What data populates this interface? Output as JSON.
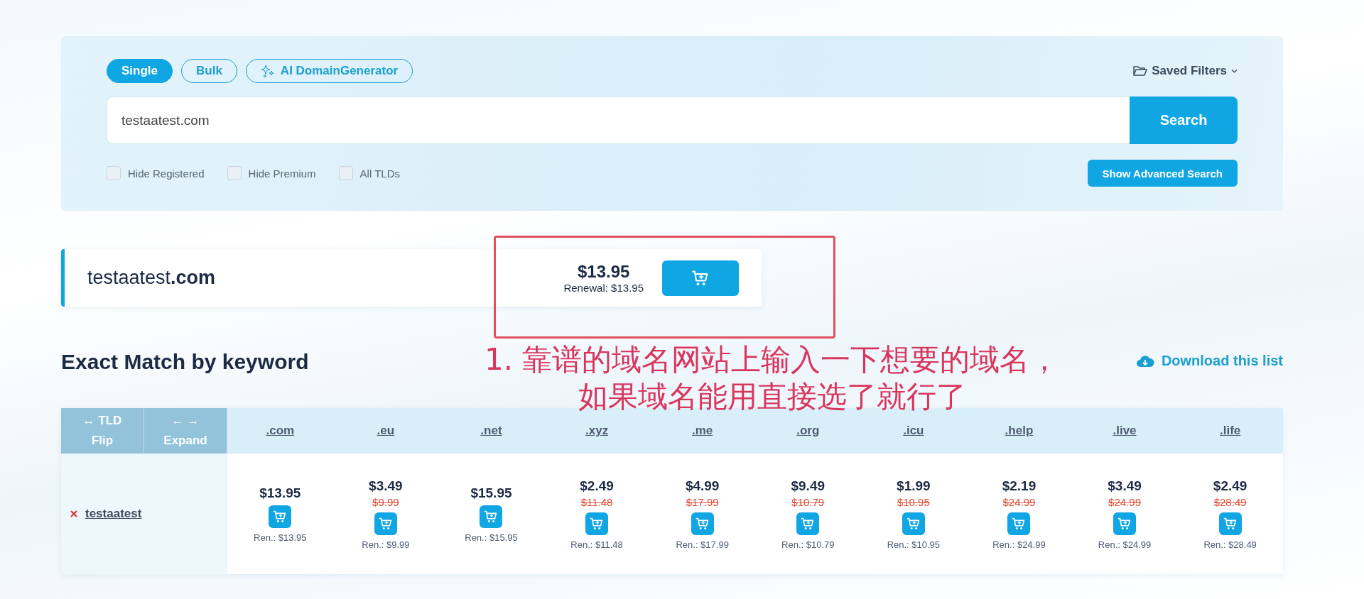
{
  "search_panel": {
    "modes": [
      {
        "label": "Single",
        "selected": true
      },
      {
        "label": "Bulk",
        "selected": false
      },
      {
        "label": "AI DomainGenerator",
        "selected": false
      }
    ],
    "saved_filters": "Saved Filters",
    "query": "testaatest.com",
    "search_button": "Search",
    "options": [
      {
        "label": "Hide Registered",
        "checked": false
      },
      {
        "label": "Hide Premium",
        "checked": false
      },
      {
        "label": "All TLDs",
        "checked": false
      }
    ],
    "advanced_button": "Show Advanced Search"
  },
  "result": {
    "name": "testaatest",
    "tld": ".com",
    "price": "$13.95",
    "renewal": "Renewal: $13.95"
  },
  "annotation": {
    "lines": [
      "1. 靠谱的域名网站上输入一下想要的域名，",
      "如果域名能用直接选了就行了"
    ]
  },
  "exact_match": {
    "title": "Exact Match by keyword",
    "download": "Download this list",
    "flip": {
      "icon": "↔",
      "label": "TLD",
      "sub": "Flip"
    },
    "expand": {
      "icon": "← →",
      "label": "Expand"
    },
    "columns": [
      ".com",
      ".eu",
      ".net",
      ".xyz",
      ".me",
      ".org",
      ".icu",
      ".help",
      ".live",
      ".life"
    ],
    "row": {
      "name": "testaatest",
      "cells": [
        {
          "price": "$13.95",
          "renewal": "Ren.: $13.95"
        },
        {
          "price": "$3.49",
          "old": "$9.99",
          "renewal": "Ren.: $9.99"
        },
        {
          "price": "$15.95",
          "renewal": "Ren.: $15.95"
        },
        {
          "price": "$2.49",
          "old": "$11.48",
          "renewal": "Ren.: $11.48"
        },
        {
          "price": "$4.99",
          "old": "$17.99",
          "renewal": "Ren.: $17.99"
        },
        {
          "price": "$9.49",
          "old": "$10.79",
          "renewal": "Ren.: $10.79"
        },
        {
          "price": "$1.99",
          "old": "$10.95",
          "renewal": "Ren.: $10.95"
        },
        {
          "price": "$2.19",
          "old": "$24.99",
          "renewal": "Ren.: $24.99"
        },
        {
          "price": "$3.49",
          "old": "$24.99",
          "renewal": "Ren.: $24.99"
        },
        {
          "price": "$2.49",
          "old": "$28.49",
          "renewal": "Ren.: $28.49"
        }
      ]
    }
  }
}
